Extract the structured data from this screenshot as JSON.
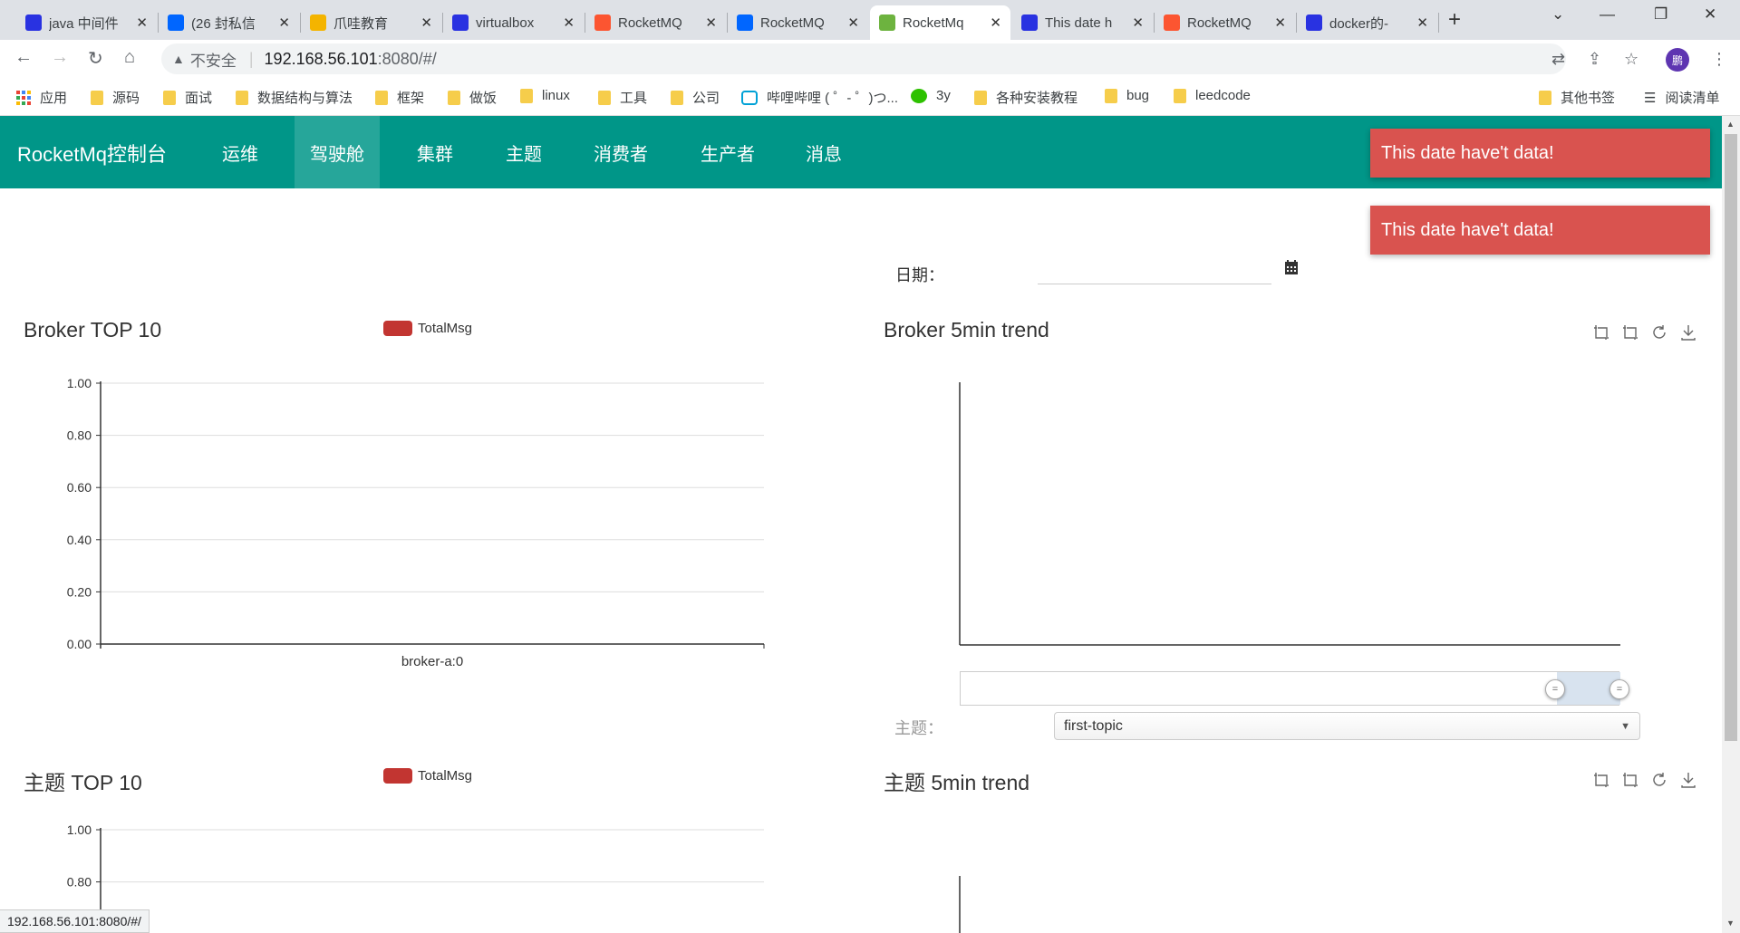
{
  "browser": {
    "tabs": [
      {
        "title": "java 中间件",
        "icon_color": "#2932e1",
        "icon": "paw-icon"
      },
      {
        "title": "(26 封私信",
        "icon_color": "#0066ff",
        "icon": "zhihu-icon"
      },
      {
        "title": "爪哇教育",
        "icon_color": "#f4b400",
        "icon": "star-icon"
      },
      {
        "title": "virtualbox",
        "icon_color": "#2932e1",
        "icon": "paw-icon"
      },
      {
        "title": "RocketMQ",
        "icon_color": "#fc5531",
        "icon": "csdn-icon"
      },
      {
        "title": "RocketMQ",
        "icon_color": "#0066ff",
        "icon": "zhihu-icon"
      },
      {
        "title": "RocketMq",
        "icon_color": "#6db33f",
        "icon": "leaf-icon",
        "active": true
      },
      {
        "title": "This date h",
        "icon_color": "#2932e1",
        "icon": "paw-icon"
      },
      {
        "title": "RocketMQ",
        "icon_color": "#fc5531",
        "icon": "csdn-icon"
      },
      {
        "title": "docker的-",
        "icon_color": "#2932e1",
        "icon": "paw-icon"
      }
    ],
    "tab_close": "✕",
    "new_tab": "+",
    "address": {
      "warning": "▲",
      "insecure": "不安全",
      "url_host": "192.168.56.101",
      "url_rest": ":8080/#/"
    },
    "bookmarks": [
      {
        "label": "应用",
        "type": "apps"
      },
      {
        "label": "源码",
        "type": "folder"
      },
      {
        "label": "面试",
        "type": "folder"
      },
      {
        "label": "数据结构与算法",
        "type": "folder"
      },
      {
        "label": "框架",
        "type": "folder"
      },
      {
        "label": "做饭",
        "type": "folder"
      },
      {
        "label": "linux",
        "type": "folder"
      },
      {
        "label": "工具",
        "type": "folder"
      },
      {
        "label": "公司",
        "type": "folder"
      },
      {
        "label": "哔哩哔哩 ( ゜- ゜)つ...",
        "type": "bilibili"
      },
      {
        "label": "3y",
        "type": "wechat"
      },
      {
        "label": "各种安装教程",
        "type": "folder"
      },
      {
        "label": "bug",
        "type": "folder"
      },
      {
        "label": "leedcode",
        "type": "folder"
      }
    ],
    "other_bookmarks": "其他书签",
    "reading_list": "阅读清单",
    "profile_initial": "鹏",
    "status_url": "192.168.56.101:8080/#/"
  },
  "app": {
    "brand": "RocketMq控制台",
    "nav": [
      "运维",
      "驾驶舱",
      "集群",
      "主题",
      "消费者",
      "生产者",
      "消息"
    ],
    "active_nav": "驾驶舱",
    "toasts": [
      "This date have't data!",
      "This date have't data!"
    ],
    "date_label": "日期：",
    "date_value": "",
    "topic_label": "主题：",
    "topic_selected": "first-topic",
    "accent": "#009688",
    "toast_color": "#d9534f",
    "series_color": "#c23531"
  },
  "chart_data": [
    {
      "type": "bar",
      "title": "Broker TOP 10",
      "legend": [
        "TotalMsg"
      ],
      "categories": [
        "broker-a:0"
      ],
      "series": [
        {
          "name": "TotalMsg",
          "values": [
            0
          ]
        }
      ],
      "yticks": [
        "0.00",
        "0.20",
        "0.40",
        "0.60",
        "0.80",
        "1.00"
      ],
      "ylim": [
        0,
        1
      ]
    },
    {
      "type": "line",
      "title": "Broker 5min trend",
      "series": []
    },
    {
      "type": "bar",
      "title": "主题 TOP 10",
      "legend": [
        "TotalMsg"
      ],
      "categories": [],
      "series": [
        {
          "name": "TotalMsg",
          "values": []
        }
      ],
      "yticks_visible": [
        "0.80",
        "1.00"
      ],
      "ylim": [
        0,
        1
      ]
    },
    {
      "type": "line",
      "title": "主题 5min trend",
      "series": []
    }
  ]
}
